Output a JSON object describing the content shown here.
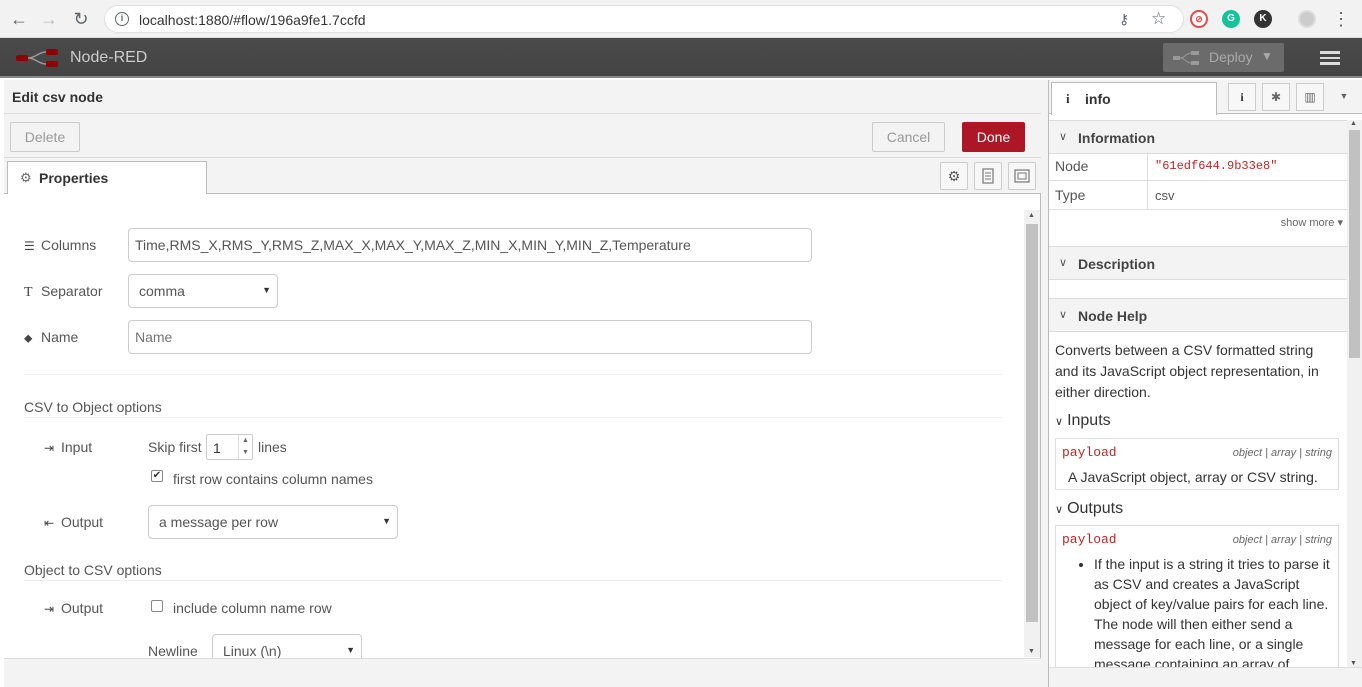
{
  "browser": {
    "url": "localhost:1880/#flow/196a9fe1.7ccfd",
    "back": "←",
    "forward": "→",
    "reload": "↻",
    "key_icon": "⚷",
    "star_icon": "☆",
    "ext_k": "K",
    "menu_dots": "⋮"
  },
  "header": {
    "title": "Node-RED",
    "deploy_label": "Deploy"
  },
  "tray": {
    "title": "Edit csv node",
    "delete_label": "Delete",
    "cancel_label": "Cancel",
    "done_label": "Done",
    "tab_label": "Properties",
    "fields": {
      "columns_label": "Columns",
      "columns_value": "Time,RMS_X,RMS_Y,RMS_Z,MAX_X,MAX_Y,MAX_Z,MIN_X,MIN_Y,MIN_Z,Temperature",
      "separator_label": "Separator",
      "separator_value": "comma",
      "name_label": "Name",
      "name_placeholder": "Name"
    },
    "csv_to_object": {
      "title": "CSV to Object options",
      "input_label": "Input",
      "skip_first": "Skip first",
      "skip_value": "1",
      "lines": "lines",
      "first_row_label": "first row contains column names",
      "first_row_checked": true,
      "output_label": "Output",
      "output_value": "a message per row"
    },
    "object_to_csv": {
      "title": "Object to CSV options",
      "output_label": "Output",
      "include_header_label": "include column name row",
      "include_header_checked": false,
      "newline_label": "Newline",
      "newline_value": "Linux (\\n)"
    }
  },
  "sidebar": {
    "tab_label": "info",
    "information_title": "Information",
    "node_key": "Node",
    "node_value": "\"61edf644.9b33e8\"",
    "type_key": "Type",
    "type_value": "csv",
    "show_more": "show more ▾",
    "description_title": "Description",
    "help_title": "Node Help",
    "help_intro": "Converts between a CSV formatted string and its JavaScript object representation, in either direction.",
    "inputs_title": "Inputs",
    "input_name": "payload",
    "input_type": "object | array | string",
    "input_desc": "A JavaScript object, array or CSV string.",
    "outputs_title": "Outputs",
    "output_name": "payload",
    "output_type": "object | array | string",
    "output_desc": "If the input is a string it tries to parse it as CSV and creates a JavaScript object of key/value pairs for each line. The node will then either send a message for each line, or a single message containing an array of"
  },
  "colors": {
    "done": "#ad1625",
    "header_bg": "#444444",
    "mono_red": "#b72828"
  }
}
